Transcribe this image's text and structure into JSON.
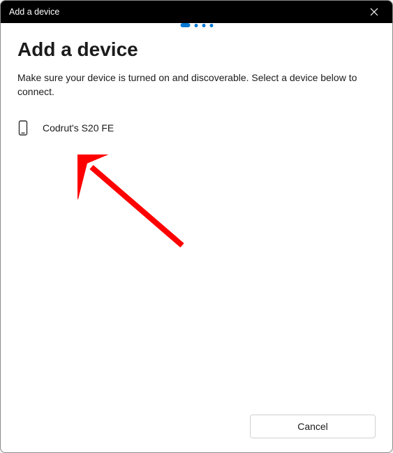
{
  "titlebar": {
    "title": "Add a device"
  },
  "main": {
    "heading": "Add a device",
    "subtext": "Make sure your device is turned on and discoverable. Select a device below to connect."
  },
  "devices": [
    {
      "name": "Codrut's S20 FE",
      "icon": "phone-icon"
    }
  ],
  "footer": {
    "cancel_label": "Cancel"
  },
  "annotation": {
    "arrow_color": "#ff0000"
  }
}
